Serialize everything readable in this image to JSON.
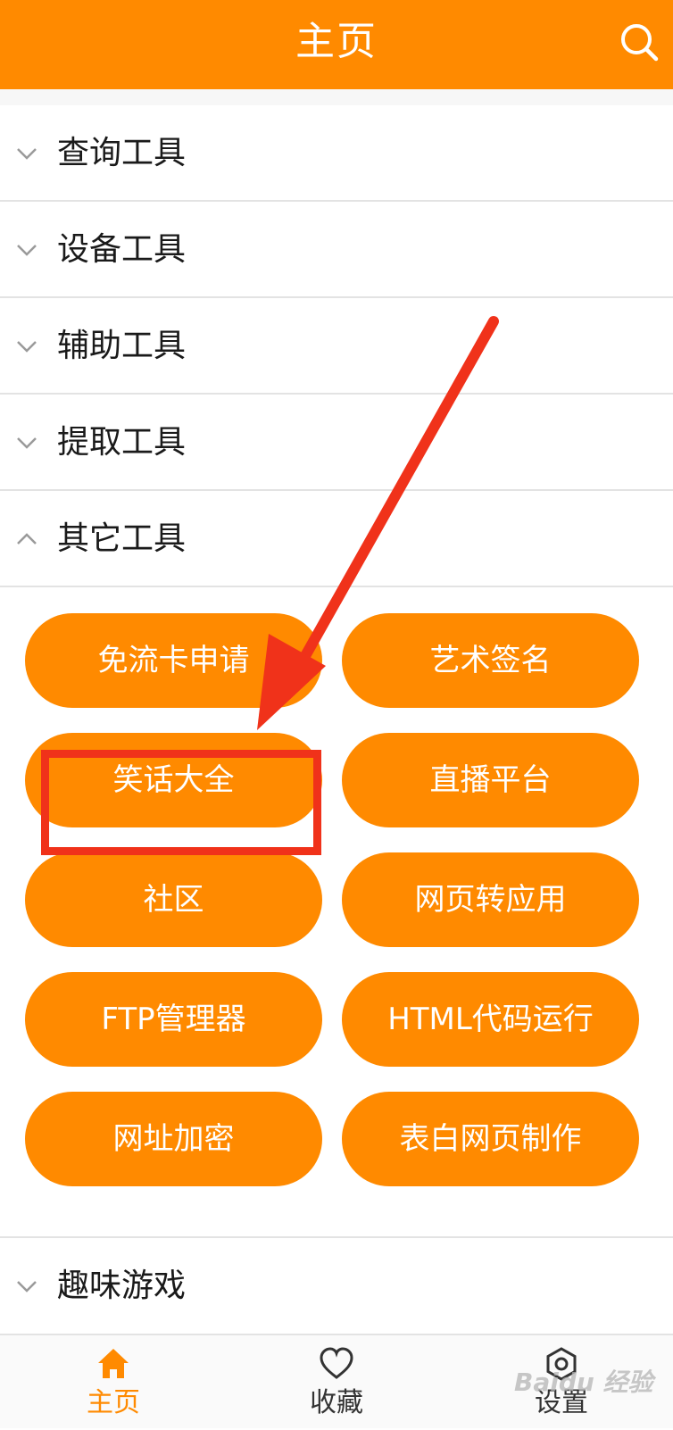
{
  "header": {
    "title": "主页",
    "search_icon": "search-icon"
  },
  "categories": [
    {
      "label": "查询工具",
      "state": "collapsed",
      "icon": "chevron-down-icon"
    },
    {
      "label": "设备工具",
      "state": "collapsed",
      "icon": "chevron-down-icon"
    },
    {
      "label": "辅助工具",
      "state": "collapsed",
      "icon": "chevron-down-icon"
    },
    {
      "label": "提取工具",
      "state": "collapsed",
      "icon": "chevron-down-icon"
    },
    {
      "label": "其它工具",
      "state": "expanded",
      "icon": "chevron-up-icon"
    },
    {
      "label": "趣味游戏",
      "state": "collapsed",
      "icon": "chevron-down-icon"
    }
  ],
  "tools": [
    "免流卡申请",
    "艺术签名",
    "笑话大全",
    "直播平台",
    "社区",
    "网页转应用",
    "FTP管理器",
    "HTML代码运行",
    "网址加密",
    "表白网页制作"
  ],
  "annotation": {
    "highlighted_tool": "笑话大全",
    "color": "#f0321a"
  },
  "tabbar": {
    "items": [
      {
        "label": "主页",
        "icon": "home-icon",
        "active": true
      },
      {
        "label": "收藏",
        "icon": "heart-icon",
        "active": false
      },
      {
        "label": "设置",
        "icon": "settings-icon",
        "active": false
      }
    ]
  },
  "watermark": "Baidu 经验",
  "colors": {
    "accent": "#ff8a00",
    "text": "#1a1a1a",
    "divider": "#e3e3e3",
    "annotation_red": "#f0321a"
  }
}
